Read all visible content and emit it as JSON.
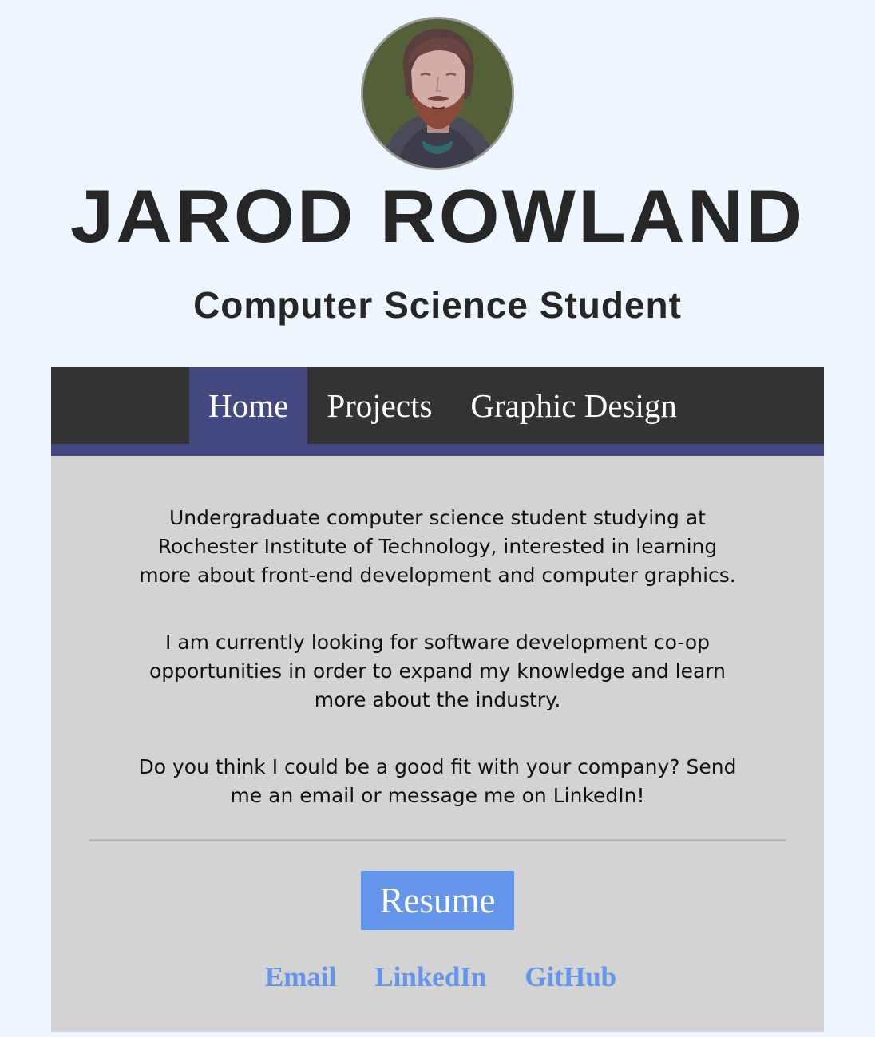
{
  "header": {
    "name": "JAROD ROWLAND",
    "subtitle": "Computer Science Student"
  },
  "nav": {
    "items": [
      {
        "label": "Home",
        "active": true
      },
      {
        "label": "Projects",
        "active": false
      },
      {
        "label": "Graphic Design",
        "active": false
      }
    ]
  },
  "main": {
    "paragraphs": [
      "Undergraduate computer science student studying at Rochester Institute of Technology, interested in learning more about front-end development and computer graphics.",
      "I am currently looking for software development co-op opportunities in order to expand my knowledge and learn more about the industry.",
      "Do you think I could be a good fit with your company? Send me an email or message me on LinkedIn!"
    ],
    "resume_label": "Resume",
    "links": [
      {
        "label": "Email"
      },
      {
        "label": "LinkedIn"
      },
      {
        "label": "GitHub"
      }
    ]
  },
  "colors": {
    "page_bg": "#eef6ff",
    "nav_bg": "#333333",
    "nav_active": "#434880",
    "card_bg": "#d3d3d3",
    "accent": "#6495ed",
    "heading": "#262626"
  },
  "icons": {
    "avatar": "avatar-illustration"
  }
}
